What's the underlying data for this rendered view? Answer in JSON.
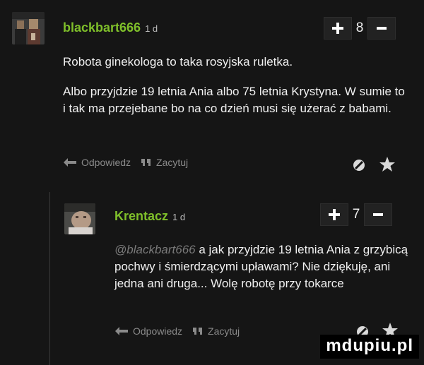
{
  "comments": [
    {
      "author": "blackbart666",
      "age": "1 d",
      "votes": "8",
      "paragraphs": [
        "Robota ginekologa to taka rosyjska ruletka.",
        "Albo przyjdzie 19 letnia Ania albo 75 letnia Krystyna. W sumie to i tak ma przejebane bo na co dzień musi się użerać z babami."
      ],
      "reply_label": "Odpowiedz",
      "quote_label": "Zacytuj"
    },
    {
      "author": "Krentacz",
      "age": "1 d",
      "votes": "7",
      "mention": "@blackbart666",
      "text": " a jak przyjdzie 19 letnia Ania z grzybicą pochwy i śmierdzącymi upławami? Nie dziękuję, ani jedna ani druga... Wolę robotę przy tokarce",
      "reply_label": "Odpowiedz",
      "quote_label": "Zacytuj"
    }
  ],
  "icons": {
    "plus": "plus-icon",
    "minus": "minus-icon",
    "reply": "reply-arrow-icon",
    "quote": "quote-icon",
    "block": "block-icon",
    "favorite": "star-icon"
  },
  "colors": {
    "background": "#151515",
    "author": "#7fbf2a",
    "muted": "#8a8a8a",
    "text": "#f0f0f0"
  },
  "watermark": "mdupiu.pl"
}
